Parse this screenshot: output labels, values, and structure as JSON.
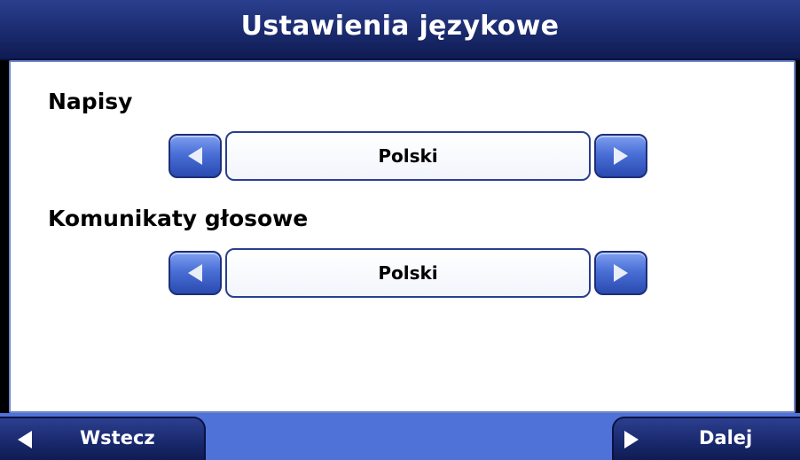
{
  "header": {
    "title": "Ustawienia językowe"
  },
  "sections": {
    "captions": {
      "label": "Napisy",
      "value": "Polski"
    },
    "voice": {
      "label": "Komunikaty głosowe",
      "value": "Polski"
    }
  },
  "footer": {
    "back_label": "Wstecz",
    "next_label": "Dalej"
  },
  "icons": {
    "prev": "arrow-left-icon",
    "next": "arrow-right-icon"
  },
  "colors": {
    "title_bar": "#1d2e74",
    "bottom_bar": "#4f72d8",
    "arrow_button": "#4a6fd6",
    "panel_border": "#6f86c8"
  }
}
